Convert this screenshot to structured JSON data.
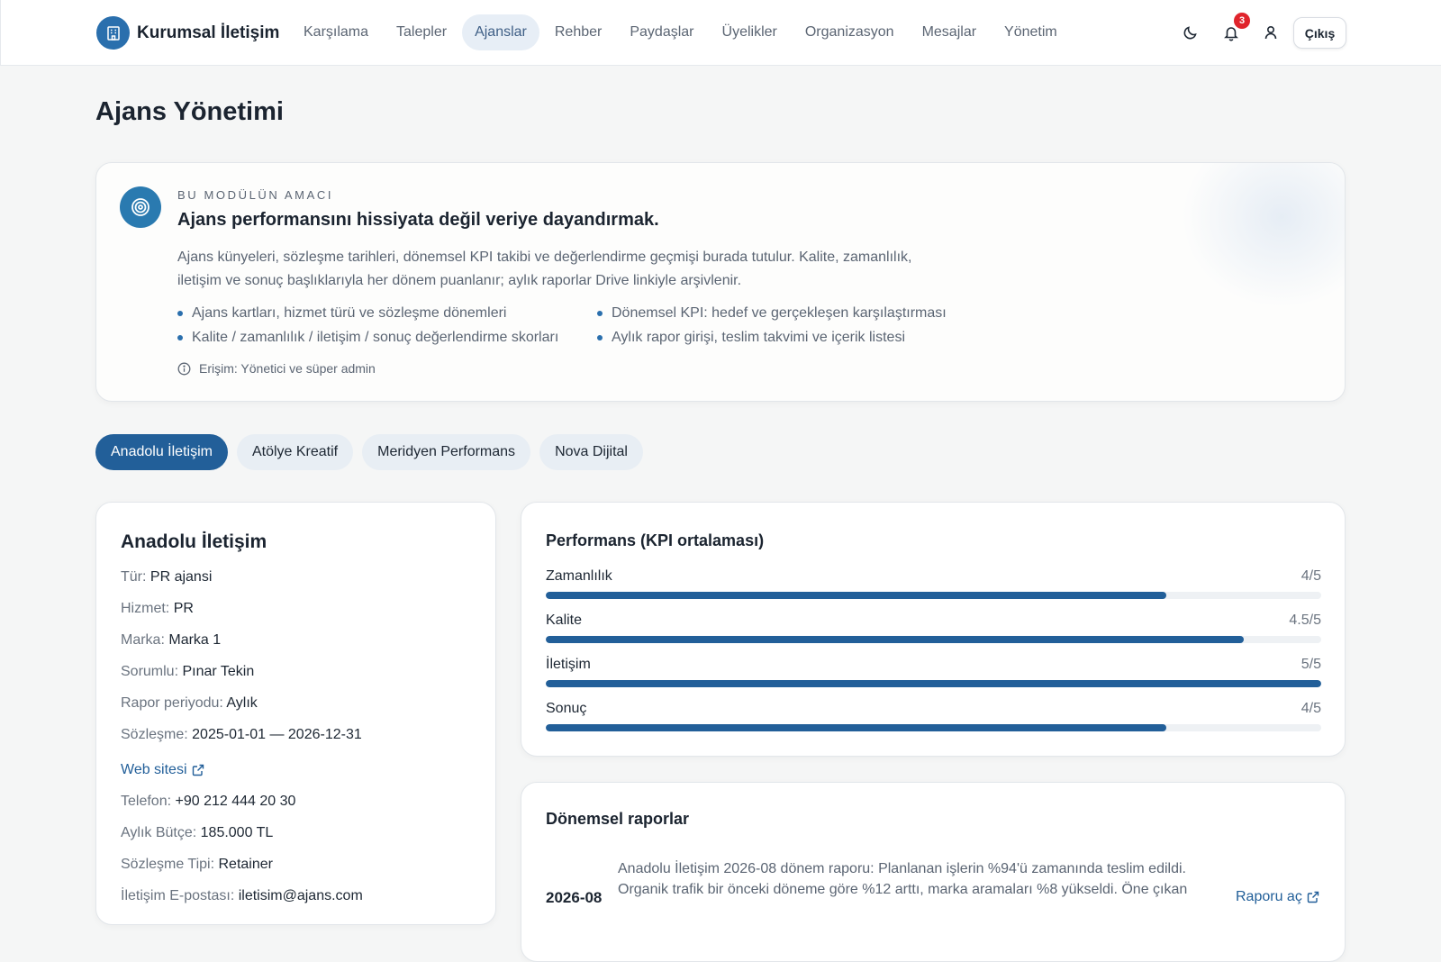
{
  "app": {
    "name": "Kurumsal İletişim"
  },
  "nav": {
    "items": [
      {
        "label": "Karşılama",
        "active": false
      },
      {
        "label": "Talepler",
        "active": false
      },
      {
        "label": "Ajanslar",
        "active": true
      },
      {
        "label": "Rehber",
        "active": false
      },
      {
        "label": "Paydaşlar",
        "active": false
      },
      {
        "label": "Üyelikler",
        "active": false
      },
      {
        "label": "Organizasyon",
        "active": false
      },
      {
        "label": "Mesajlar",
        "active": false
      },
      {
        "label": "Yönetim",
        "active": false
      }
    ]
  },
  "topbar": {
    "theme_icon": "moon-icon",
    "notification_icon": "bell-icon",
    "notification_count": "3",
    "user_icon": "user-icon",
    "logout_label": "Çıkış"
  },
  "page": {
    "title": "Ajans Yönetimi"
  },
  "purpose": {
    "eyebrow": "BU MODÜLÜN AMACI",
    "heading": "Ajans performansını hissiyata değil veriye dayandırmak.",
    "description": "Ajans künyeleri, sözleşme tarihleri, dönemsel KPI takibi ve değerlendirme geçmişi burada tutulur. Kalite, zamanlılık, iletişim ve sonuç başlıklarıyla her dönem puanlanır; aylık raporlar Drive linkiyle arşivlenir.",
    "bullets": [
      "Ajans kartları, hizmet türü ve sözleşme dönemleri",
      "Dönemsel KPI: hedef ve gerçekleşen karşılaştırması",
      "Kalite / zamanlılık / iletişim / sonuç değerlendirme skorları",
      "Aylık rapor girişi, teslim takvimi ve içerik listesi"
    ],
    "access": "Erişim: Yönetici ve süper admin"
  },
  "agency_tabs": [
    {
      "label": "Anadolu İletişim",
      "active": true
    },
    {
      "label": "Atölye Kreatif",
      "active": false
    },
    {
      "label": "Meridyen Performans",
      "active": false
    },
    {
      "label": "Nova Dijital",
      "active": false
    }
  ],
  "agency": {
    "name": "Anadolu İletişim",
    "details": [
      {
        "label": "Tür:",
        "value": "PR ajansi"
      },
      {
        "label": "Hizmet:",
        "value": "PR"
      },
      {
        "label": "Marka:",
        "value": "Marka 1"
      },
      {
        "label": "Sorumlu:",
        "value": "Pınar Tekin"
      },
      {
        "label": "Rapor periyodu:",
        "value": "Aylık"
      },
      {
        "label": "Sözleşme:",
        "value": "2025-01-01 — 2026-12-31"
      }
    ],
    "website_label": "Web sitesi",
    "contact": [
      {
        "label": "Telefon:",
        "value": "+90 212 444 20 30"
      },
      {
        "label": "Aylık Bütçe:",
        "value": "185.000 TL"
      },
      {
        "label": "Sözleşme Tipi:",
        "value": "Retainer"
      },
      {
        "label": "İletişim E-postası:",
        "value": "iletisim@ajans.com"
      }
    ]
  },
  "performance": {
    "title": "Performans (KPI ortalaması)",
    "kpis": [
      {
        "label": "Zamanlılık",
        "score": "4/5",
        "value": 4
      },
      {
        "label": "Kalite",
        "score": "4.5/5",
        "value": 4.5
      },
      {
        "label": "İletişim",
        "score": "5/5",
        "value": 5
      },
      {
        "label": "Sonuç",
        "score": "4/5",
        "value": 4
      }
    ],
    "max": 5
  },
  "reports": {
    "title": "Dönemsel raporlar",
    "items": [
      {
        "period": "2026-08",
        "summary": "Anadolu İletişim 2026-08 dönem raporu: Planlanan işlerin %94'ü zamanında teslim edildi. Organik trafik bir önceki döneme göre %12 arttı, marka aramaları %8 yükseldi. Öne çıkan",
        "link_label": "Raporu aç"
      }
    ]
  },
  "colors": {
    "accent": "#225f99",
    "brand": "#2a6fad",
    "badge": "#e0242c"
  }
}
